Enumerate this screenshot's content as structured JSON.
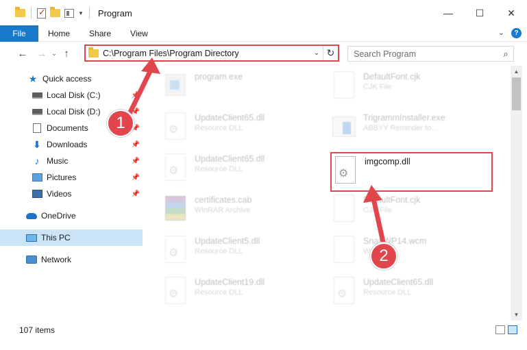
{
  "window": {
    "title": "Program",
    "controls": {
      "minimize": "—",
      "maximize": "☐",
      "close": "✕"
    }
  },
  "ribbon": {
    "file_tab": "File",
    "tabs": [
      "Home",
      "Share",
      "View"
    ],
    "expand": "⌄",
    "help": "?"
  },
  "nav": {
    "back": "←",
    "forward": "→",
    "recent": "⌄",
    "up": "↑",
    "address": "C:\\Program Files\\Program Directory",
    "address_drop": "⌄",
    "refresh": "↻",
    "search_placeholder": "Search Program",
    "search_icon": "⌕"
  },
  "sidebar": {
    "items": [
      {
        "label": "Quick access",
        "icon": "star-icon",
        "pinned": false
      },
      {
        "label": "Local Disk (C:)",
        "icon": "disk-icon",
        "pinned": true
      },
      {
        "label": "Local Disk (D:)",
        "icon": "disk-icon",
        "pinned": true
      },
      {
        "label": "Documents",
        "icon": "documents-icon",
        "pinned": true
      },
      {
        "label": "Downloads",
        "icon": "download-icon",
        "pinned": true
      },
      {
        "label": "Music",
        "icon": "music-icon",
        "pinned": true
      },
      {
        "label": "Pictures",
        "icon": "pictures-icon",
        "pinned": true
      },
      {
        "label": "Videos",
        "icon": "videos-icon",
        "pinned": true
      },
      {
        "label": "OneDrive",
        "icon": "cloud-icon",
        "pinned": false
      },
      {
        "label": "This PC",
        "icon": "pc-icon",
        "pinned": false,
        "selected": true
      },
      {
        "label": "Network",
        "icon": "network-icon",
        "pinned": false
      }
    ]
  },
  "files": {
    "left": [
      {
        "name": "program.exe",
        "type": "",
        "icon": "exe"
      },
      {
        "name": "UpdateClient65.dll",
        "type": "Resource DLL",
        "icon": "dll"
      },
      {
        "name": "UpdateClient65.dll",
        "type": "Resource DLL",
        "icon": "dll"
      },
      {
        "name": "certificates.cab",
        "type": "WinRAR Archive",
        "icon": "cab"
      },
      {
        "name": "UpdateClient5.dll",
        "type": "Resource DLL",
        "icon": "dll"
      },
      {
        "name": "UpdateClient19.dll",
        "type": "Resource DLL",
        "icon": "dll"
      }
    ],
    "right": [
      {
        "name": "DefaultFont.cjk",
        "type": "CJK File",
        "icon": "blank"
      },
      {
        "name": "TrigrammInstaller.exe",
        "type": "ABBYY Reminder to...",
        "icon": "installer"
      },
      {
        "name": "DefaultFont.cjk",
        "type": "CJK File",
        "icon": "blank"
      },
      {
        "name": "SnapWP14.wcm",
        "type": "WCM File",
        "icon": "blank"
      },
      {
        "name": "UpdateClient65.dll",
        "type": "Resource DLL",
        "icon": "dll"
      }
    ],
    "highlighted": {
      "name": "imgcomp.dll",
      "type": "",
      "icon": "dll"
    }
  },
  "scrollbar": {
    "up": "▲",
    "down": "▼"
  },
  "status": {
    "items": "107 items"
  },
  "annotations": {
    "badge1": "1",
    "badge2": "2",
    "color": "#e0464c"
  }
}
